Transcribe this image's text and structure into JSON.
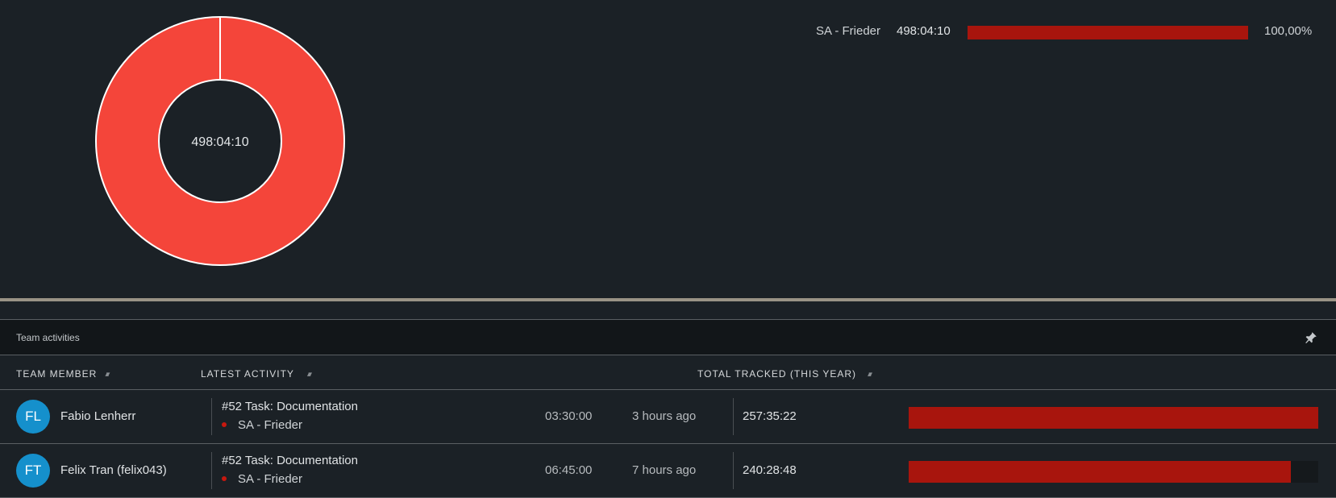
{
  "summary_chart": {
    "center_label": "498:04:10",
    "legend": [
      {
        "name": "SA - Frieder",
        "time": "498:04:10",
        "percent": "100,00%",
        "share": 1.0
      }
    ],
    "slice_color": "#f4453a",
    "bar_color": "#a8150d"
  },
  "team_panel": {
    "title": "Team activities",
    "pin_icon": "pin-icon",
    "columns": {
      "member": "TEAM MEMBER",
      "activity": "LATEST ACTIVITY",
      "total": "TOTAL TRACKED (THIS YEAR)"
    },
    "rows": [
      {
        "initials": "FL",
        "name": "Fabio Lenherr",
        "task": "#52 Task: Documentation",
        "project": "SA - Frieder",
        "duration": "03:30:00",
        "ago": "3 hours ago",
        "total": "257:35:22",
        "total_fraction": 1.0
      },
      {
        "initials": "FT",
        "name": "Felix Tran (felix043)",
        "task": "#52 Task: Documentation",
        "project": "SA - Frieder",
        "duration": "06:45:00",
        "ago": "7 hours ago",
        "total": "240:28:48",
        "total_fraction": 0.934
      }
    ],
    "avatar_color": "#1590cc",
    "bar_color": "#a8150d"
  }
}
